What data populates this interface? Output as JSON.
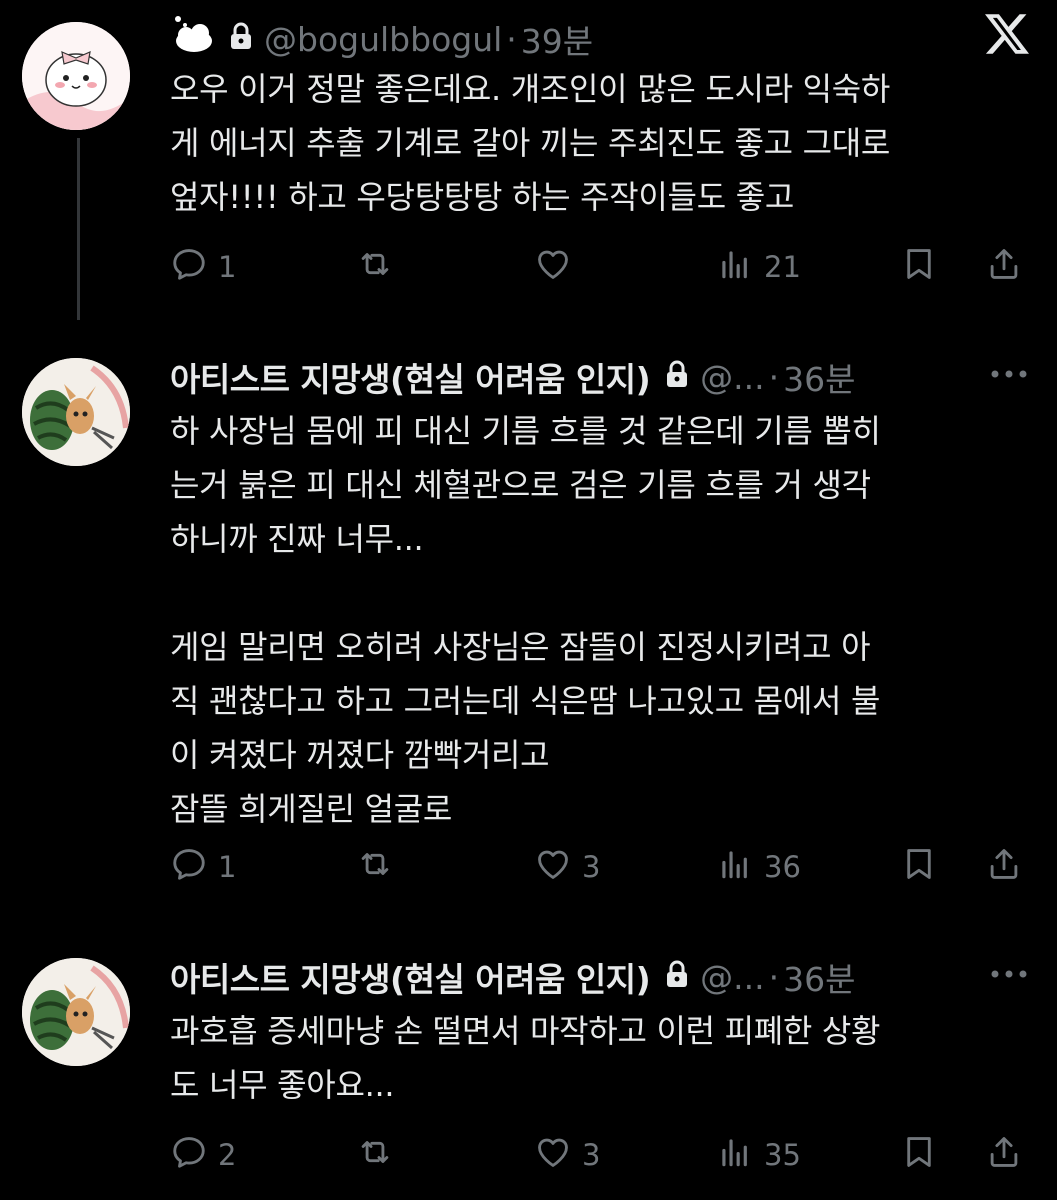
{
  "brand": {
    "logo_icon": "x-logo"
  },
  "tweets": [
    {
      "display_name_icon": "cloud-emoji-icon",
      "handle": "@bogulbbogul",
      "dot": "·",
      "time": "39분",
      "text": "오우 이거 정말 좋은데요. 개조인이 많은 도시라 익숙하\n게 에너지 추출 기계로 갈아 끼는 주최진도 좋고 그대로\n엎자!!!! 하고 우당탕탕탕 하는 주작이들도 좋고",
      "replies": "1",
      "retweets": "",
      "likes": "",
      "views": "21"
    },
    {
      "display_name": "아티스트 지망생(현실 어려움 인지)",
      "handle": "@...",
      "dot": "·",
      "time": "36분",
      "text": "하 사장님 몸에 피 대신 기름 흐를 것 같은데 기름 뽑히\n는거 붉은 피 대신 체혈관으로 검은 기름 흐를 거 생각\n하니까 진짜 너무...\n\n게임 말리면 오히려 사장님은 잠뜰이 진정시키려고 아\n직 괜찮다고 하고 그러는데 식은땀 나고있고 몸에서 불\n이 켜졌다 꺼졌다 깜빡거리고\n잠뜰 희게질린 얼굴로",
      "replies": "1",
      "retweets": "",
      "likes": "3",
      "views": "36"
    },
    {
      "display_name": "아티스트 지망생(현실 어려움 인지)",
      "handle": "@...",
      "dot": "·",
      "time": "36분",
      "text": "과호흡 증세마냥 손 떨면서 마작하고 이런 피폐한 상황\n도 너무 좋아요...",
      "replies": "2",
      "retweets": "",
      "likes": "3",
      "views": "35"
    }
  ],
  "colors": {
    "bg": "#000000",
    "text": "#e7e9ea",
    "muted": "#71767b",
    "thread": "#333639"
  }
}
